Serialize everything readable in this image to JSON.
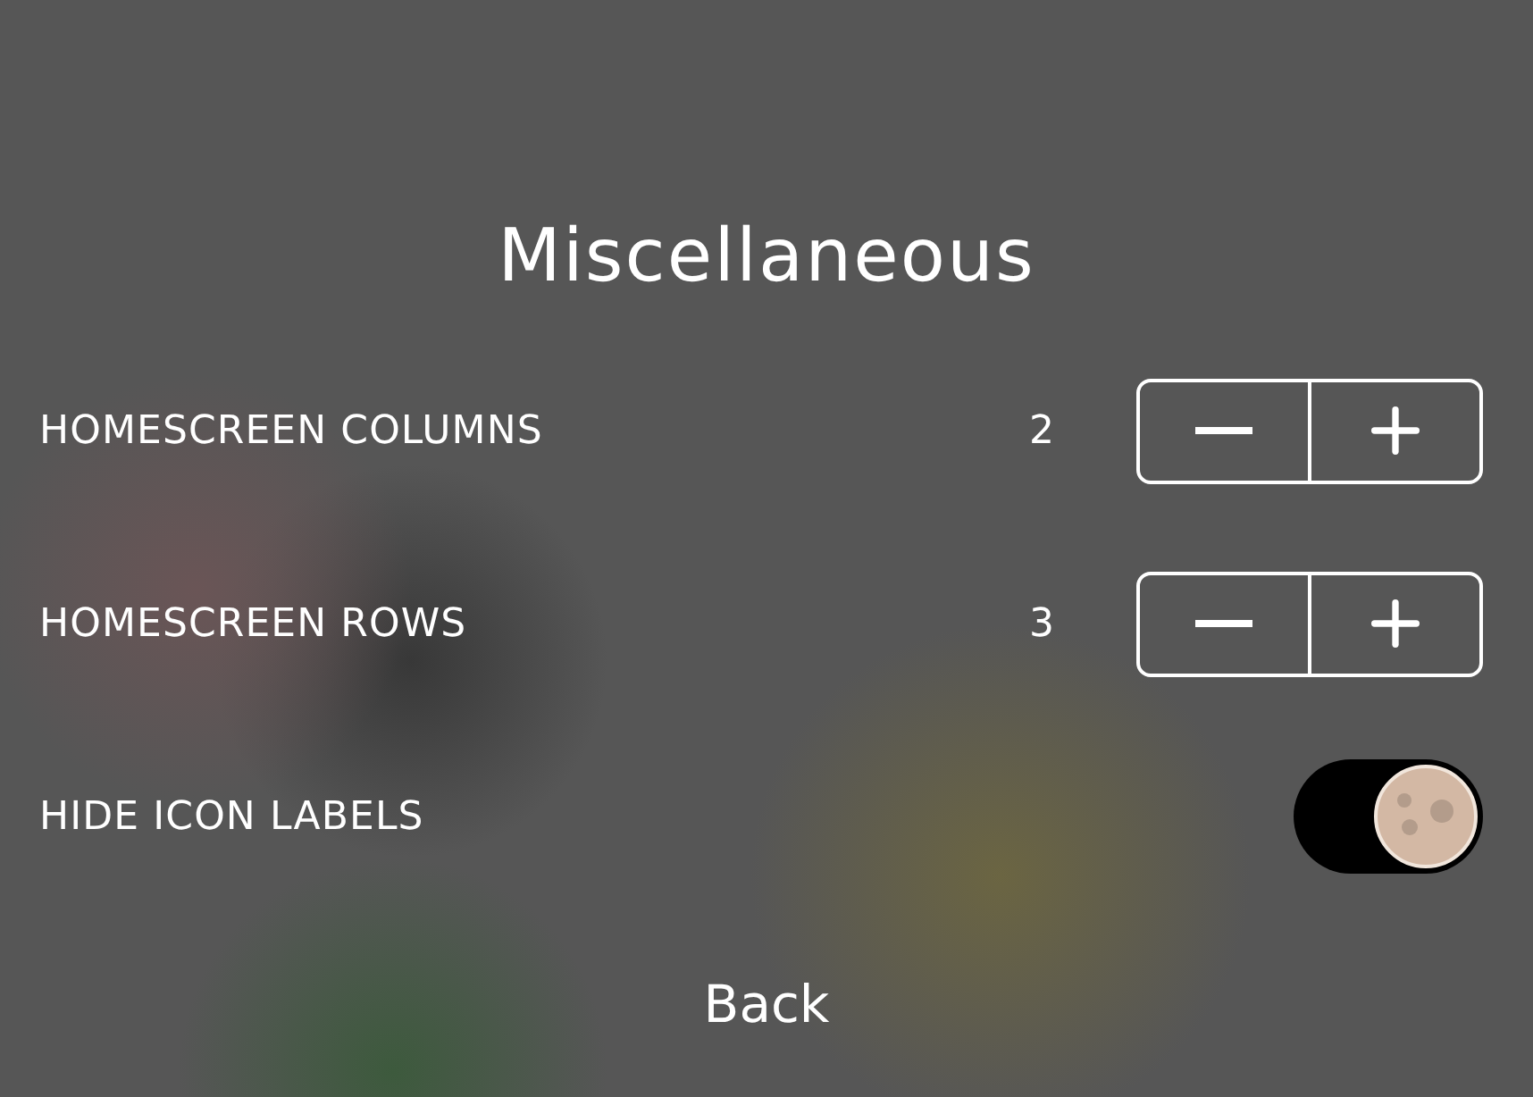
{
  "title": "Miscellaneous",
  "settings": [
    {
      "kind": "stepper",
      "label": "HOMESCREEN COLUMNS",
      "value": "2"
    },
    {
      "kind": "stepper",
      "label": "HOMESCREEN ROWS",
      "value": "3"
    },
    {
      "kind": "toggle",
      "label": "HIDE ICON LABELS",
      "on": true
    }
  ],
  "back": "Back"
}
